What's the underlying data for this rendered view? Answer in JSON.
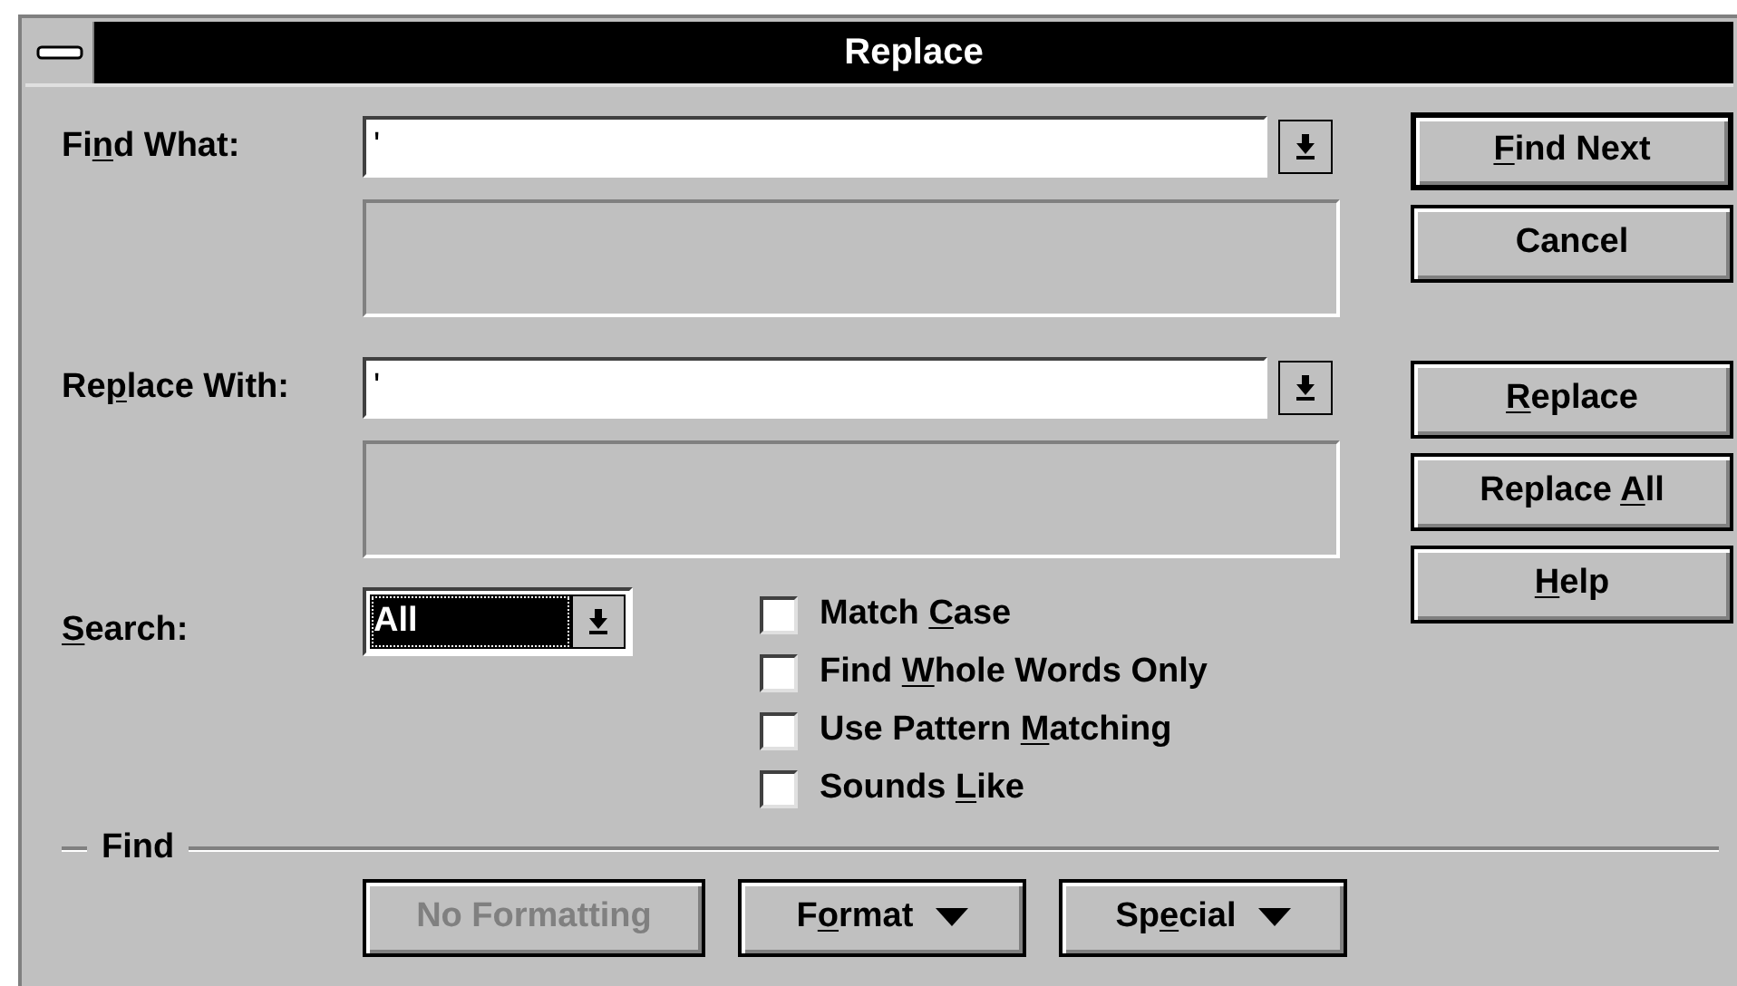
{
  "window": {
    "title": "Replace"
  },
  "find_what": {
    "label": {
      "before": "Fi",
      "key": "n",
      "after": "d What:"
    },
    "value": "'"
  },
  "replace_with": {
    "label": {
      "before": "Re",
      "key": "p",
      "after": "lace With:"
    },
    "value": "'"
  },
  "search": {
    "label": {
      "key": "S",
      "after": "earch:"
    },
    "value": "All"
  },
  "options": [
    {
      "label": {
        "before": "Match ",
        "key": "C",
        "after": "ase"
      },
      "checked": false
    },
    {
      "label": {
        "before": "Find ",
        "key": "W",
        "after": "hole Words Only"
      },
      "checked": false
    },
    {
      "label": {
        "before": "Use Pattern ",
        "key": "M",
        "after": "atching"
      },
      "checked": false
    },
    {
      "label": {
        "before": "Sounds ",
        "key": "L",
        "after": "ike"
      },
      "checked": false
    }
  ],
  "side_button_groups": [
    [
      {
        "label": {
          "key": "F",
          "after": "ind Next"
        },
        "default": true
      },
      {
        "label": {
          "before": "Cancel"
        },
        "default": false
      }
    ],
    [
      {
        "label": {
          "key": "R",
          "after": "eplace"
        },
        "default": false
      },
      {
        "label": {
          "before": "Replace ",
          "key": "A",
          "after": "ll"
        },
        "default": false
      },
      {
        "label": {
          "key": "H",
          "after": "elp"
        },
        "default": false
      }
    ]
  ],
  "find_group": {
    "label": "Find"
  },
  "find_buttons": [
    {
      "label": {
        "before": "No Formatting"
      },
      "kind": "plain",
      "disabled": true
    },
    {
      "label": {
        "before": "F",
        "key": "o",
        "after": "rmat"
      },
      "kind": "dropdown",
      "disabled": false
    },
    {
      "label": {
        "before": "Sp",
        "key": "e",
        "after": "cial"
      },
      "kind": "dropdown",
      "disabled": false
    }
  ]
}
